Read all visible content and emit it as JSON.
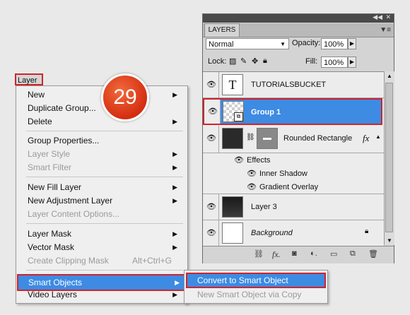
{
  "menu": {
    "title": "Layer",
    "items": [
      {
        "label": "New",
        "submenu": true,
        "disabled": false
      },
      {
        "label": "Duplicate Group...",
        "submenu": false,
        "disabled": false
      },
      {
        "label": "Delete",
        "submenu": true,
        "disabled": false
      },
      {
        "label": "Group Properties...",
        "submenu": false,
        "disabled": false
      },
      {
        "label": "Layer Style",
        "submenu": true,
        "disabled": true
      },
      {
        "label": "Smart Filter",
        "submenu": true,
        "disabled": true
      },
      {
        "label": "New Fill Layer",
        "submenu": true,
        "disabled": false
      },
      {
        "label": "New Adjustment Layer",
        "submenu": true,
        "disabled": false
      },
      {
        "label": "Layer Content Options...",
        "submenu": false,
        "disabled": true
      },
      {
        "label": "Layer Mask",
        "submenu": true,
        "disabled": false
      },
      {
        "label": "Vector Mask",
        "submenu": true,
        "disabled": false
      },
      {
        "label": "Create Clipping Mask",
        "shortcut": "Alt+Ctrl+G",
        "submenu": false,
        "disabled": true
      },
      {
        "label": "Smart Objects",
        "submenu": true,
        "disabled": false,
        "highlighted": true
      },
      {
        "label": "Video Layers",
        "submenu": true,
        "disabled": false
      }
    ]
  },
  "submenu": {
    "convert": "Convert to Smart Object",
    "new_via_copy": "New Smart Object via Copy"
  },
  "step_badge": "29",
  "panel": {
    "tab": "LAYERS",
    "blend_mode": "Normal",
    "opacity_label": "Opacity:",
    "opacity_value": "100%",
    "lock_label": "Lock:",
    "fill_label": "Fill:",
    "fill_value": "100%",
    "layers": {
      "tutorialsbucket": "TUTORIALSBUCKET",
      "text_thumb": "T",
      "group1": "Group 1",
      "rounded_rect": "Rounded Rectangle",
      "fx": "fx",
      "effects": "Effects",
      "inner_shadow": "Inner Shadow",
      "gradient_overlay": "Gradient Overlay",
      "layer3": "Layer 3",
      "background": "Background"
    }
  },
  "colors": {
    "selection_blue": "#3d8be3",
    "highlight_red": "#d1232a",
    "badge_orange": "#e04a22"
  }
}
